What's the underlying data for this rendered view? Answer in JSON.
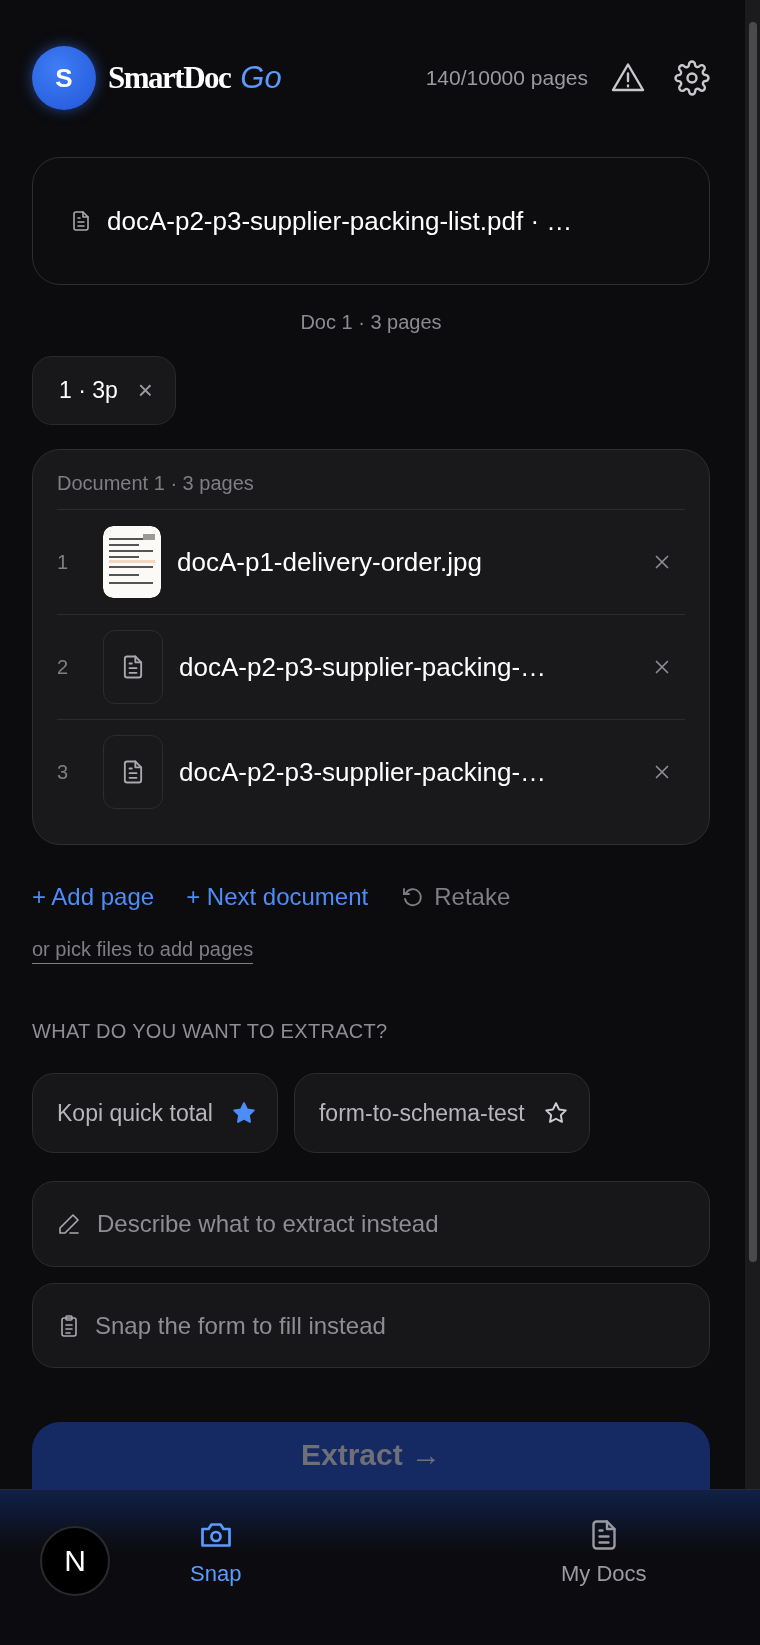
{
  "header": {
    "avatar": "S",
    "brand": "SmartDoc",
    "brand_suffix": "Go",
    "usage": "140/10000 pages"
  },
  "current_file": {
    "name": "docA-p2-p3-supplier-packing-list.pdf · …"
  },
  "doc_summary": "Doc 1 · 3 pages",
  "doc_chips": [
    {
      "label": "1 · 3p",
      "remove": "×"
    }
  ],
  "document": {
    "title": "Document 1 · 3 pages",
    "pages": [
      {
        "number": "1",
        "name": "docA-p1-delivery-order.jpg"
      },
      {
        "number": "2",
        "name": "docA-p2-p3-supplier-packing-…",
        "kind": "file"
      },
      {
        "number": "3",
        "name": "docA-p2-p3-supplier-packing-…",
        "kind": "file"
      }
    ]
  },
  "actions": {
    "add_page": "+ Add page",
    "next_document": "+ Next document",
    "retake": "Retake",
    "pick_files": "or pick files to add pages"
  },
  "extract_section": {
    "label": "WHAT DO YOU WANT TO EXTRACT?",
    "templates": [
      {
        "name": "Kopi quick total",
        "favorite": true
      },
      {
        "name": "form-to-schema-test",
        "favorite": false
      }
    ],
    "describe_placeholder": "Describe what to extract instead",
    "snap_form": "Snap the form to fill instead"
  },
  "extract_button": "Extract →",
  "dev_badge": "N",
  "nav": [
    {
      "label": "Snap",
      "kind": "camera",
      "selected": true
    },
    {
      "label": "My Docs",
      "kind": "docs",
      "selected": false
    }
  ]
}
